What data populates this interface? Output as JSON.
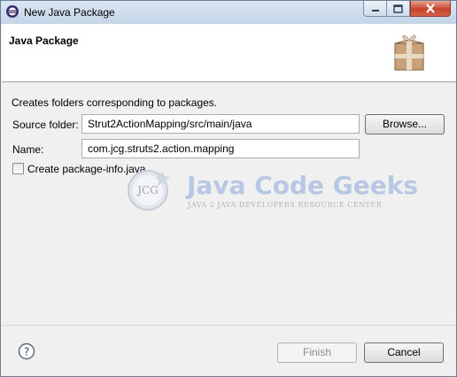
{
  "window": {
    "title": "New Java Package",
    "icon": "eclipse-icon"
  },
  "banner": {
    "title": "Java Package",
    "icon": "package-icon"
  },
  "form": {
    "description": "Creates folders corresponding to packages.",
    "source_folder_label": "Source folder:",
    "source_folder_value": "Strut2ActionMapping/src/main/java",
    "browse_label": "Browse...",
    "name_label": "Name:",
    "name_value": "com.jcg.struts2.action.mapping",
    "package_info_label": "Create package-info.java",
    "package_info_checked": false
  },
  "watermark": {
    "logo_text": "JCG",
    "title": "Java Code Geeks",
    "subtitle": "JAVA 2 JAVA DEVELOPERS RESOURCE CENTER"
  },
  "footer": {
    "help_icon": "help-icon",
    "finish_label": "Finish",
    "cancel_label": "Cancel"
  }
}
